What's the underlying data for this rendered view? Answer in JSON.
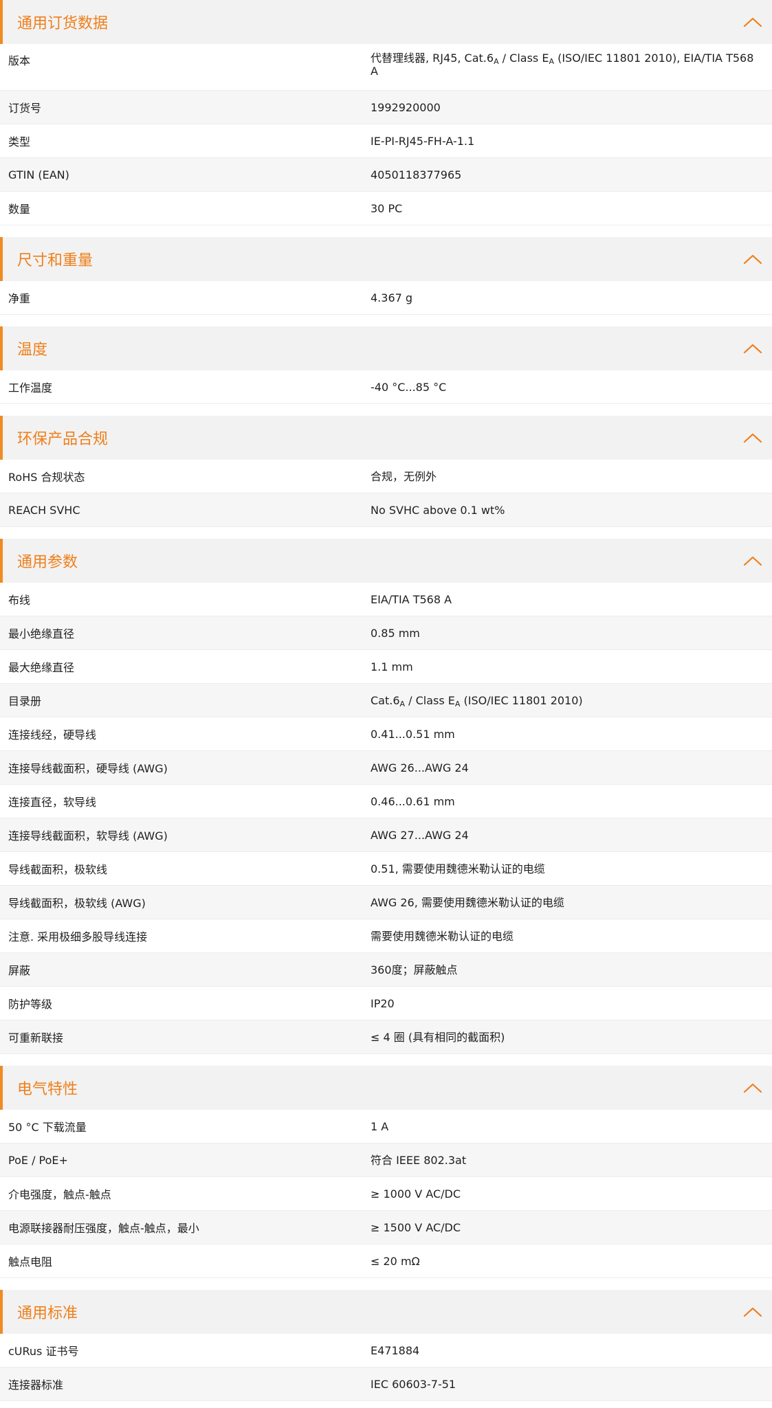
{
  "colors": {
    "accent": "#ef7f1a",
    "header_bg": "#f2f2f2",
    "row_alt_bg": "#f6f6f6",
    "text": "#1f1f1f"
  },
  "icons": {
    "collapse": "chevron-up-icon"
  },
  "sections": [
    {
      "key": "ordering",
      "title": "通用订货数据",
      "rows": [
        {
          "label": "版本",
          "value": [
            "代替理线器, RJ45, Cat.6",
            {
              "sub": "A"
            },
            " / Class E",
            {
              "sub": "A"
            },
            " (ISO/IEC 11801 2010), EIA/TIA T568 A"
          ]
        },
        {
          "label": "订货号",
          "value": "1992920000"
        },
        {
          "label": "类型",
          "value": "IE-PI-RJ45-FH-A-1.1"
        },
        {
          "label": "GTIN (EAN)",
          "value": "4050118377965"
        },
        {
          "label": "数量",
          "value": "30  PC"
        }
      ]
    },
    {
      "key": "dimensions",
      "title": "尺寸和重量",
      "rows": [
        {
          "label": "净重",
          "value": "4.367  g"
        }
      ]
    },
    {
      "key": "temperature",
      "title": "温度",
      "rows": [
        {
          "label": "工作温度",
          "value": "-40 °C...85 °C"
        }
      ]
    },
    {
      "key": "environment",
      "title": "环保产品合规",
      "rows": [
        {
          "label": "RoHS 合规状态",
          "value": "合规，无例外"
        },
        {
          "label": "REACH SVHC",
          "value": "No SVHC above 0.1 wt%"
        }
      ]
    },
    {
      "key": "general",
      "title": "通用参数",
      "rows": [
        {
          "label": "布线",
          "value": "EIA/TIA T568 A"
        },
        {
          "label": "最小绝缘直径",
          "value": "0.85  mm"
        },
        {
          "label": "最大绝缘直径",
          "value": "1.1  mm"
        },
        {
          "label": "目录册",
          "value": [
            "Cat.6",
            {
              "sub": "A"
            },
            " / Class E",
            {
              "sub": "A"
            },
            " (ISO/IEC 11801 2010)"
          ]
        },
        {
          "label": "连接线经，硬导线",
          "value": "0.41...0.51 mm"
        },
        {
          "label": "连接导线截面积，硬导线 (AWG)",
          "value": "AWG 26...AWG 24"
        },
        {
          "label": "连接直径，软导线",
          "value": "0.46...0.61 mm"
        },
        {
          "label": "连接导线截面积，软导线 (AWG)",
          "value": "AWG 27...AWG 24"
        },
        {
          "label": "导线截面积，极软线",
          "value": "0.51, 需要使用魏德米勒认证的电缆"
        },
        {
          "label": "导线截面积，极软线 (AWG)",
          "value": "AWG 26, 需要使用魏德米勒认证的电缆"
        },
        {
          "label": "注意. 采用极细多股导线连接",
          "value": "需要使用魏德米勒认证的电缆"
        },
        {
          "label": "屏蔽",
          "value": "360度；屏蔽触点"
        },
        {
          "label": "防护等级",
          "value": "IP20"
        },
        {
          "label": "可重新联接",
          "value": "≤ 4 圈 (具有相同的截面积)"
        }
      ]
    },
    {
      "key": "electrical",
      "title": "电气特性",
      "rows": [
        {
          "label": "50 °C 下载流量",
          "value": "1  A"
        },
        {
          "label": "PoE / PoE+",
          "value": "符合 IEEE 802.3at"
        },
        {
          "label": "介电强度，触点-触点",
          "value": "≥ 1000 V AC/DC"
        },
        {
          "label": "电源联接器耐压强度，触点-触点，最小",
          "value": "≥ 1500 V AC/DC"
        },
        {
          "label": "触点电阻",
          "value": "≤ 20 mΩ"
        }
      ]
    },
    {
      "key": "standards",
      "title": "通用标准",
      "rows": [
        {
          "label": "cURus 证书号",
          "value": "E471884"
        },
        {
          "label": "连接器标准",
          "value": "IEC 60603-7-51"
        }
      ]
    }
  ]
}
